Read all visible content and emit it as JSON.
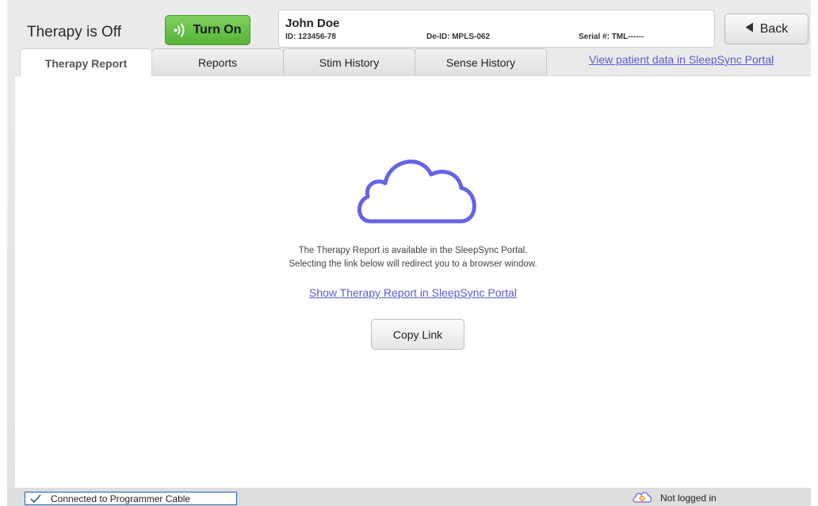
{
  "header": {
    "therapy_status": "Therapy is Off",
    "turn_on_label": "Turn On",
    "back_label": "Back"
  },
  "patient": {
    "name": "John Doe",
    "id": "ID: 123456-78",
    "deid": "De-ID: MPLS-062",
    "serial": "Serial #: TML------"
  },
  "tabs": [
    {
      "label": "Therapy Report",
      "active": true
    },
    {
      "label": "Reports",
      "active": false
    },
    {
      "label": "Stim History",
      "active": false
    },
    {
      "label": "Sense History",
      "active": false
    }
  ],
  "portal_link": "View patient data in SleepSync Portal",
  "main": {
    "icon": "cloud-icon",
    "message_line1": "The Therapy Report is available in the SleepSync Portal.",
    "message_line2": "Selecting the link below will redirect you to a browser window.",
    "report_link": "Show Therapy Report in SleepSync Portal",
    "copy_link_label": "Copy Link"
  },
  "status_bar": {
    "connection": "Connected to Programmer Cable",
    "login": "Not logged in"
  },
  "colors": {
    "accent": "#6464e6",
    "turn_on_green": "#5cb83a",
    "link": "#5b5bd6",
    "connection_border": "#1f5fb3",
    "login_icon": "#f0a030"
  }
}
